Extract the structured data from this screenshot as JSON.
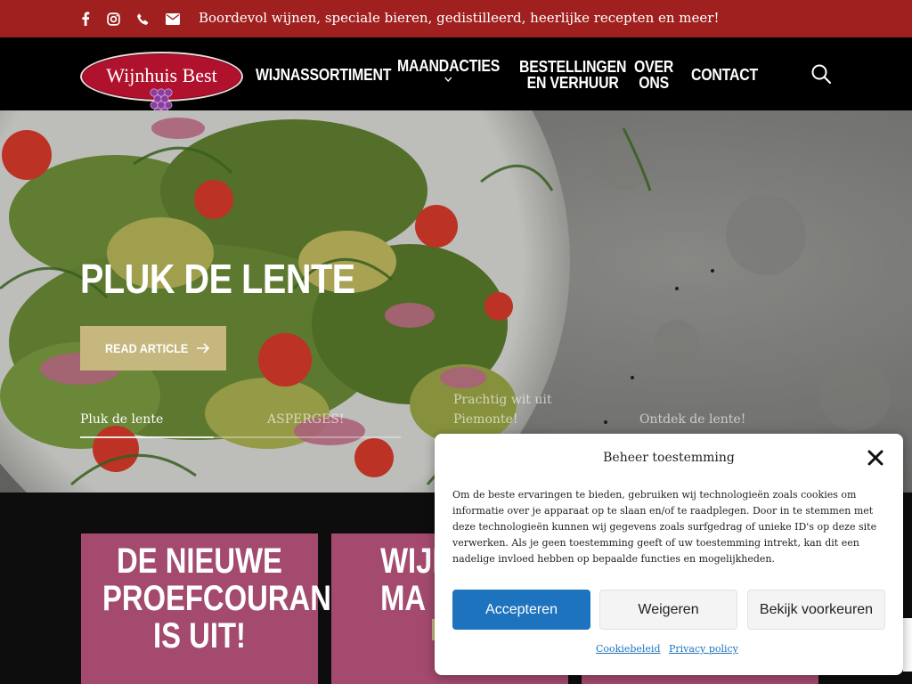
{
  "topbar": {
    "background": "#a0201f",
    "icons": [
      "facebook-icon",
      "instagram-icon",
      "phone-icon",
      "email-icon"
    ],
    "tagline": "Boordevol wijnen, speciale bieren, gedistilleerd, heerlijke recepten en meer!"
  },
  "header": {
    "logo_text": "Wijnhuis Best",
    "nav": {
      "wijnassortiment": "WIJNASSORTIMENT",
      "maandacties": "MAANDACTIES",
      "bestellingen_l1": "BESTELLINGEN",
      "bestellingen_l2": "EN VERHUUR",
      "over_l1": "OVER",
      "over_l2": "ONS",
      "contact": "CONTACT"
    }
  },
  "hero": {
    "title": "PLUK DE LENTE",
    "button_label": "READ ARTICLE",
    "accent": "#c6b77f",
    "tabs": {
      "t1": "Pluk de lente",
      "t2": "ASPERGES!",
      "t3_l1": "Prachtig wit uit",
      "t3_l2": "Piemonte!",
      "t4": "Ontdek de lente!"
    }
  },
  "cards": {
    "color": "#a34a6e",
    "card1_title": "DE NIEUWE\nPROEFCOURANT\nIS UIT!",
    "card2_title": "WIJN\nMA"
  },
  "consent": {
    "title": "Beheer toestemming",
    "body": "Om de beste ervaringen te bieden, gebruiken wij technologieën zoals cookies om informatie over je apparaat op te slaan en/of te raadplegen. Door in te stemmen met deze technologieën kunnen wij gegevens zoals surfgedrag of unieke ID's op deze site verwerken. Als je geen toestemming geeft of uw toestemming intrekt, kan dit een nadelige invloed hebben op bepaalde functies en mogelijkheden.",
    "accept_label": "Accepteren",
    "deny_label": "Weigeren",
    "preferences_label": "Bekijk voorkeuren",
    "cookie_policy_link": "Cookiebeleid",
    "privacy_policy_link": "Privacy policy",
    "primary_color": "#1e73be"
  }
}
